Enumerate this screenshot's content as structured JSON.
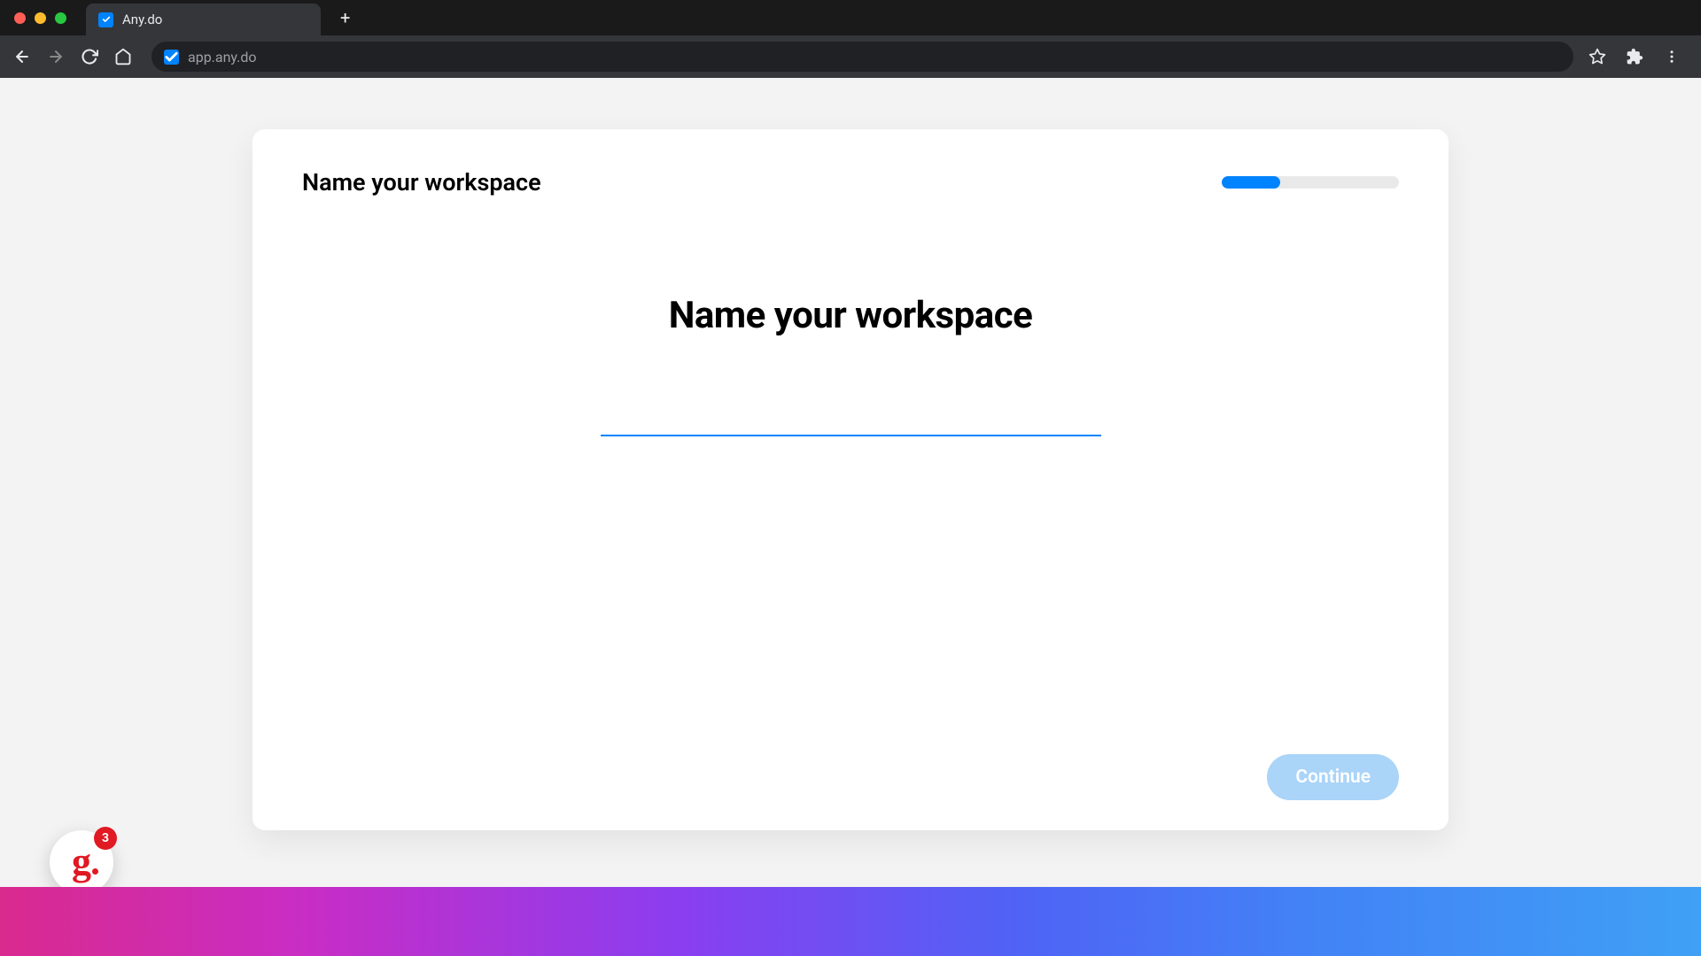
{
  "browser": {
    "tab_title": "Any.do",
    "url": "app.any.do"
  },
  "card": {
    "step_label": "Name your workspace",
    "heading": "Name your workspace",
    "input_value": "",
    "input_placeholder": "",
    "continue_label": "Continue",
    "progress_percent": 33
  },
  "widget": {
    "letter": "g",
    "badge_count": "3"
  }
}
